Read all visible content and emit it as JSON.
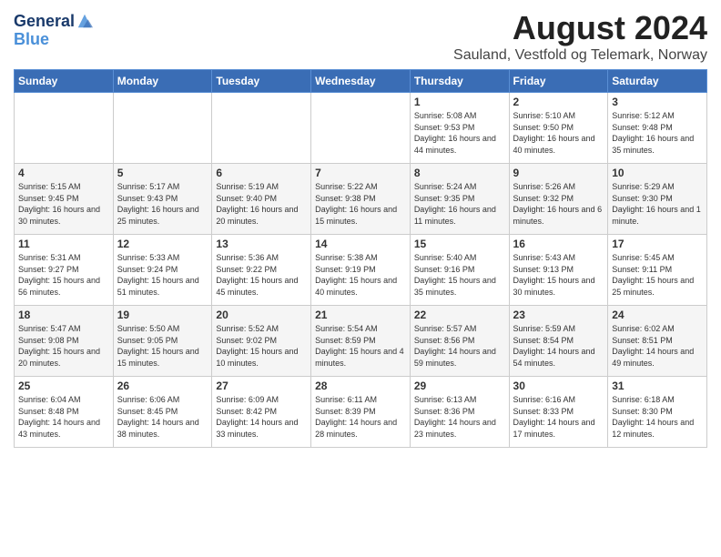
{
  "header": {
    "logo_line1": "General",
    "logo_line2": "Blue",
    "main_title": "August 2024",
    "subtitle": "Sauland, Vestfold og Telemark, Norway"
  },
  "days_of_week": [
    "Sunday",
    "Monday",
    "Tuesday",
    "Wednesday",
    "Thursday",
    "Friday",
    "Saturday"
  ],
  "weeks": [
    [
      {
        "num": "",
        "text": ""
      },
      {
        "num": "",
        "text": ""
      },
      {
        "num": "",
        "text": ""
      },
      {
        "num": "",
        "text": ""
      },
      {
        "num": "1",
        "text": "Sunrise: 5:08 AM\nSunset: 9:53 PM\nDaylight: 16 hours and 44 minutes."
      },
      {
        "num": "2",
        "text": "Sunrise: 5:10 AM\nSunset: 9:50 PM\nDaylight: 16 hours and 40 minutes."
      },
      {
        "num": "3",
        "text": "Sunrise: 5:12 AM\nSunset: 9:48 PM\nDaylight: 16 hours and 35 minutes."
      }
    ],
    [
      {
        "num": "4",
        "text": "Sunrise: 5:15 AM\nSunset: 9:45 PM\nDaylight: 16 hours and 30 minutes."
      },
      {
        "num": "5",
        "text": "Sunrise: 5:17 AM\nSunset: 9:43 PM\nDaylight: 16 hours and 25 minutes."
      },
      {
        "num": "6",
        "text": "Sunrise: 5:19 AM\nSunset: 9:40 PM\nDaylight: 16 hours and 20 minutes."
      },
      {
        "num": "7",
        "text": "Sunrise: 5:22 AM\nSunset: 9:38 PM\nDaylight: 16 hours and 15 minutes."
      },
      {
        "num": "8",
        "text": "Sunrise: 5:24 AM\nSunset: 9:35 PM\nDaylight: 16 hours and 11 minutes."
      },
      {
        "num": "9",
        "text": "Sunrise: 5:26 AM\nSunset: 9:32 PM\nDaylight: 16 hours and 6 minutes."
      },
      {
        "num": "10",
        "text": "Sunrise: 5:29 AM\nSunset: 9:30 PM\nDaylight: 16 hours and 1 minute."
      }
    ],
    [
      {
        "num": "11",
        "text": "Sunrise: 5:31 AM\nSunset: 9:27 PM\nDaylight: 15 hours and 56 minutes."
      },
      {
        "num": "12",
        "text": "Sunrise: 5:33 AM\nSunset: 9:24 PM\nDaylight: 15 hours and 51 minutes."
      },
      {
        "num": "13",
        "text": "Sunrise: 5:36 AM\nSunset: 9:22 PM\nDaylight: 15 hours and 45 minutes."
      },
      {
        "num": "14",
        "text": "Sunrise: 5:38 AM\nSunset: 9:19 PM\nDaylight: 15 hours and 40 minutes."
      },
      {
        "num": "15",
        "text": "Sunrise: 5:40 AM\nSunset: 9:16 PM\nDaylight: 15 hours and 35 minutes."
      },
      {
        "num": "16",
        "text": "Sunrise: 5:43 AM\nSunset: 9:13 PM\nDaylight: 15 hours and 30 minutes."
      },
      {
        "num": "17",
        "text": "Sunrise: 5:45 AM\nSunset: 9:11 PM\nDaylight: 15 hours and 25 minutes."
      }
    ],
    [
      {
        "num": "18",
        "text": "Sunrise: 5:47 AM\nSunset: 9:08 PM\nDaylight: 15 hours and 20 minutes."
      },
      {
        "num": "19",
        "text": "Sunrise: 5:50 AM\nSunset: 9:05 PM\nDaylight: 15 hours and 15 minutes."
      },
      {
        "num": "20",
        "text": "Sunrise: 5:52 AM\nSunset: 9:02 PM\nDaylight: 15 hours and 10 minutes."
      },
      {
        "num": "21",
        "text": "Sunrise: 5:54 AM\nSunset: 8:59 PM\nDaylight: 15 hours and 4 minutes."
      },
      {
        "num": "22",
        "text": "Sunrise: 5:57 AM\nSunset: 8:56 PM\nDaylight: 14 hours and 59 minutes."
      },
      {
        "num": "23",
        "text": "Sunrise: 5:59 AM\nSunset: 8:54 PM\nDaylight: 14 hours and 54 minutes."
      },
      {
        "num": "24",
        "text": "Sunrise: 6:02 AM\nSunset: 8:51 PM\nDaylight: 14 hours and 49 minutes."
      }
    ],
    [
      {
        "num": "25",
        "text": "Sunrise: 6:04 AM\nSunset: 8:48 PM\nDaylight: 14 hours and 43 minutes."
      },
      {
        "num": "26",
        "text": "Sunrise: 6:06 AM\nSunset: 8:45 PM\nDaylight: 14 hours and 38 minutes."
      },
      {
        "num": "27",
        "text": "Sunrise: 6:09 AM\nSunset: 8:42 PM\nDaylight: 14 hours and 33 minutes."
      },
      {
        "num": "28",
        "text": "Sunrise: 6:11 AM\nSunset: 8:39 PM\nDaylight: 14 hours and 28 minutes."
      },
      {
        "num": "29",
        "text": "Sunrise: 6:13 AM\nSunset: 8:36 PM\nDaylight: 14 hours and 23 minutes."
      },
      {
        "num": "30",
        "text": "Sunrise: 6:16 AM\nSunset: 8:33 PM\nDaylight: 14 hours and 17 minutes."
      },
      {
        "num": "31",
        "text": "Sunrise: 6:18 AM\nSunset: 8:30 PM\nDaylight: 14 hours and 12 minutes."
      }
    ]
  ]
}
